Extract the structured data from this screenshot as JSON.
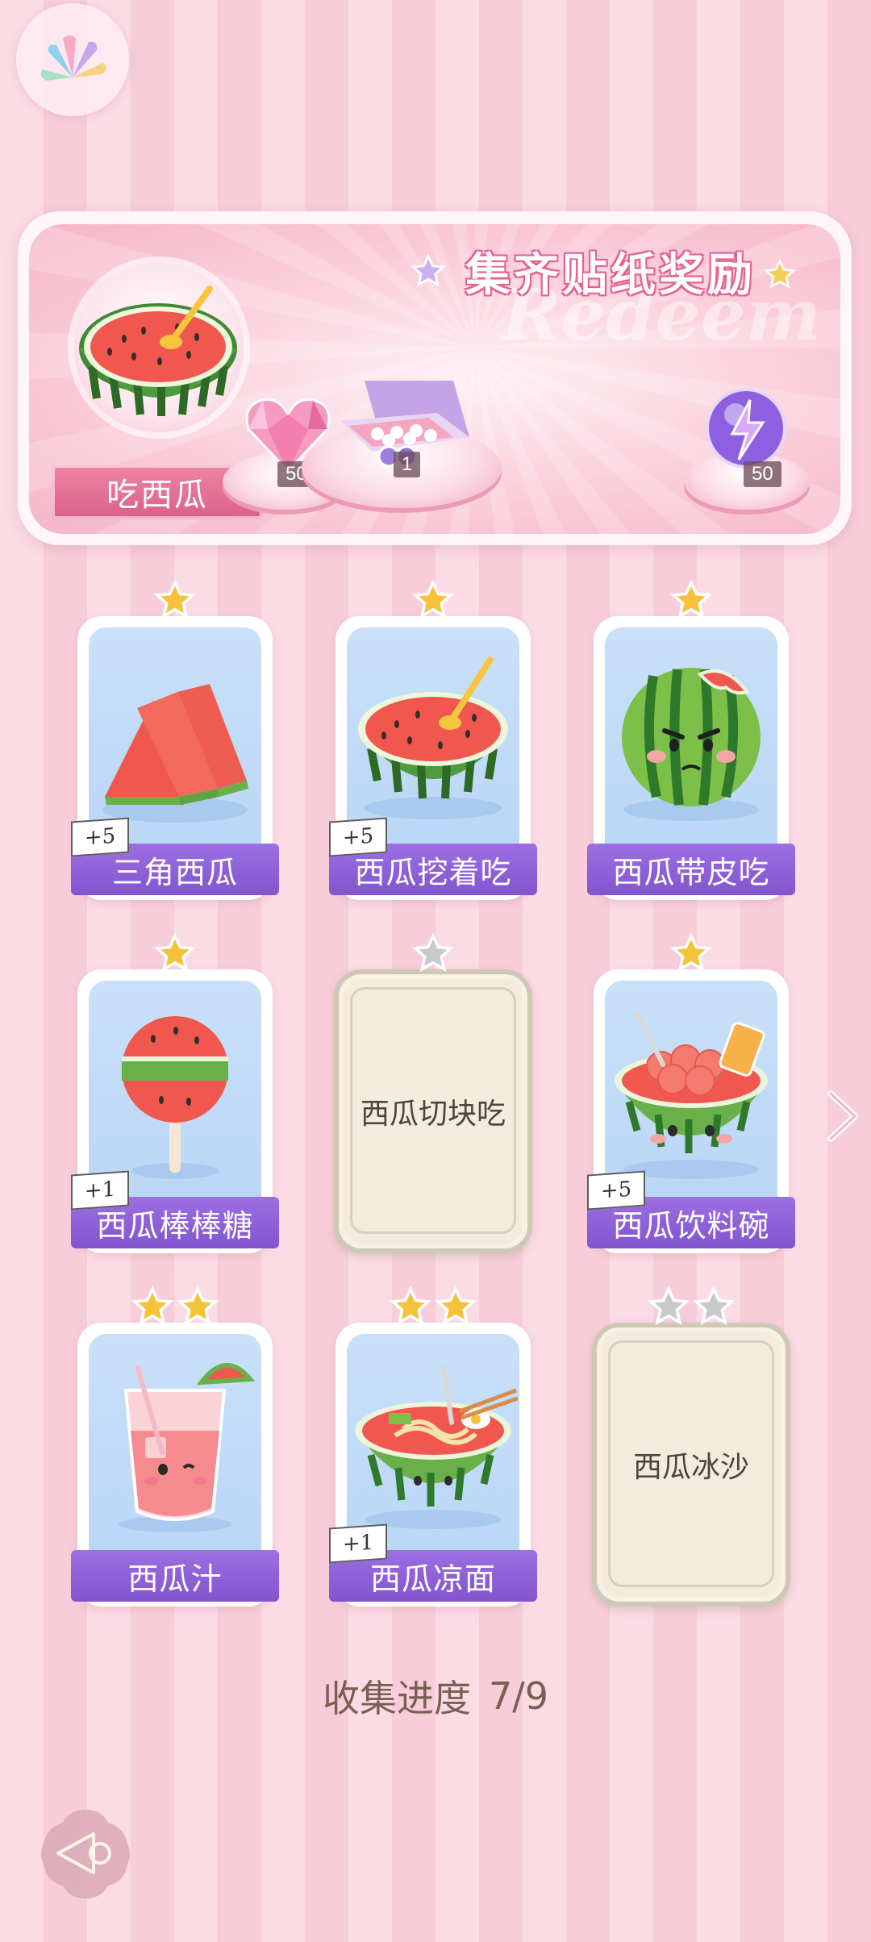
{
  "banner": {
    "title": "集齐贴纸奖励",
    "watermark": "Redeem",
    "main_reward_label": "吃西瓜",
    "rewards": [
      {
        "icon": "pink-heart-gem-icon",
        "qty": "50"
      },
      {
        "icon": "gift-box-icon",
        "qty": "1"
      },
      {
        "icon": "purple-energy-orb-icon",
        "qty": "50"
      }
    ]
  },
  "cards": [
    {
      "name": "三角西瓜",
      "stars": 1,
      "collected": true,
      "bonus": "+5",
      "art": "watermark-slices"
    },
    {
      "name": "西瓜挖着吃",
      "stars": 1,
      "collected": true,
      "bonus": "+5",
      "art": "watermelon-half-spoon"
    },
    {
      "name": "西瓜带皮吃",
      "stars": 1,
      "collected": true,
      "bonus": "",
      "art": "angry-watermelon"
    },
    {
      "name": "西瓜棒棒糖",
      "stars": 1,
      "collected": true,
      "bonus": "+1",
      "art": "watermelon-lollipop"
    },
    {
      "name": "西瓜切块吃",
      "stars": 1,
      "collected": false,
      "bonus": "",
      "art": ""
    },
    {
      "name": "西瓜饮料碗",
      "stars": 1,
      "collected": true,
      "bonus": "+5",
      "art": "watermelon-drink-bowl"
    },
    {
      "name": "西瓜汁",
      "stars": 2,
      "collected": true,
      "bonus": "",
      "art": "watermelon-juice"
    },
    {
      "name": "西瓜凉面",
      "stars": 2,
      "collected": true,
      "bonus": "+1",
      "art": "watermelon-noodles"
    },
    {
      "name": "西瓜冰沙",
      "stars": 2,
      "collected": false,
      "bonus": "",
      "art": ""
    }
  ],
  "progress": {
    "label": "收集进度",
    "value": "7/9",
    "collected": 7,
    "total": 9
  },
  "colors": {
    "accent_pink": "#e5628f",
    "label_purple": "#8354cf",
    "star_gold": "#f6c23a",
    "star_gray": "#c9c9c9"
  }
}
